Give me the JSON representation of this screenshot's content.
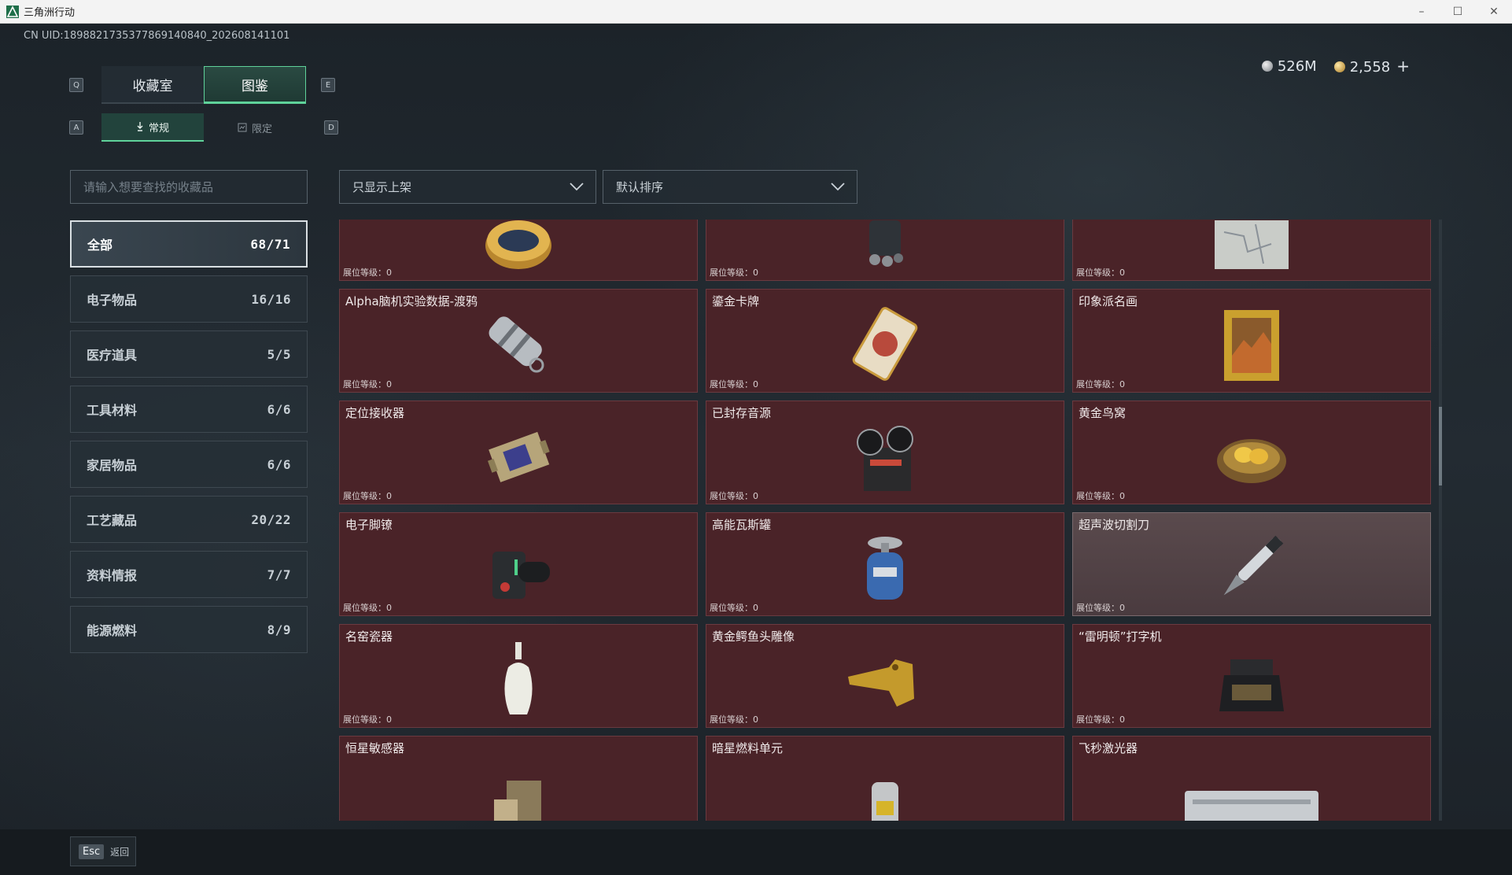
{
  "window": {
    "title": "三角洲行动"
  },
  "uid": "CN UID:1898821735377869140840_202608141101",
  "currency": {
    "silver": "526M",
    "gold": "2,558",
    "plus": "+"
  },
  "tabs": [
    {
      "label": "收藏室"
    },
    {
      "label": "图鉴"
    }
  ],
  "tab_keys": {
    "left": "Q",
    "right": "E"
  },
  "subtabs": [
    {
      "label": "常规"
    },
    {
      "label": "限定"
    }
  ],
  "subtab_keys": {
    "left": "A",
    "right": "D"
  },
  "search": {
    "placeholder": "请输入想要查找的收藏品"
  },
  "filters": {
    "shelf": "只显示上架",
    "sort": "默认排序"
  },
  "categories": [
    {
      "label": "全部",
      "count": "68/71"
    },
    {
      "label": "电子物品",
      "count": "16/16"
    },
    {
      "label": "医疗道具",
      "count": "5/5"
    },
    {
      "label": "工具材料",
      "count": "6/6"
    },
    {
      "label": "家居物品",
      "count": "6/6"
    },
    {
      "label": "工艺藏品",
      "count": "20/22"
    },
    {
      "label": "资料情报",
      "count": "7/7"
    },
    {
      "label": "能源燃料",
      "count": "8/9"
    }
  ],
  "items": [
    {
      "name": "",
      "level": "展位等级：0",
      "icon": "caviar-tin-icon"
    },
    {
      "name": "",
      "level": "展位等级：0",
      "icon": "mech-device-icon"
    },
    {
      "name": "",
      "level": "展位等级：0",
      "icon": "map-document-icon"
    },
    {
      "name": "Alpha脑机实验数据-渡鸦",
      "level": "展位等级：0",
      "icon": "data-capsule-icon"
    },
    {
      "name": "鎏金卡牌",
      "level": "展位等级：0",
      "icon": "gilded-card-icon"
    },
    {
      "name": "印象派名画",
      "level": "展位等级：0",
      "icon": "framed-painting-icon"
    },
    {
      "name": "定位接收器",
      "level": "展位等级：0",
      "icon": "locator-receiver-icon"
    },
    {
      "name": "已封存音源",
      "level": "展位等级：0",
      "icon": "reel-recorder-icon"
    },
    {
      "name": "黄金鸟窝",
      "level": "展位等级：0",
      "icon": "golden-nest-icon"
    },
    {
      "name": "电子脚镣",
      "level": "展位等级：0",
      "icon": "ankle-monitor-icon"
    },
    {
      "name": "高能瓦斯罐",
      "level": "展位等级：0",
      "icon": "gas-canister-icon"
    },
    {
      "name": "超声波切割刀",
      "level": "展位等级：0",
      "icon": "ultrasonic-knife-icon"
    },
    {
      "name": "名窑瓷器",
      "level": "展位等级：0",
      "icon": "porcelain-vase-icon"
    },
    {
      "name": "黄金鳄鱼头雕像",
      "level": "展位等级：0",
      "icon": "gold-crocodile-icon"
    },
    {
      "name": "“雷明顿”打字机",
      "level": "展位等级：0",
      "icon": "typewriter-icon"
    },
    {
      "name": "恒星敏感器",
      "level": "",
      "icon": "star-sensor-icon"
    },
    {
      "name": "暗星燃料单元",
      "level": "",
      "icon": "fuel-cell-icon"
    },
    {
      "name": "飞秒激光器",
      "level": "",
      "icon": "femto-laser-icon"
    }
  ],
  "footer": {
    "esc_key": "Esc",
    "back_label": "返回"
  },
  "colors": {
    "accent": "#5fd29a",
    "card": "#4a2328"
  }
}
